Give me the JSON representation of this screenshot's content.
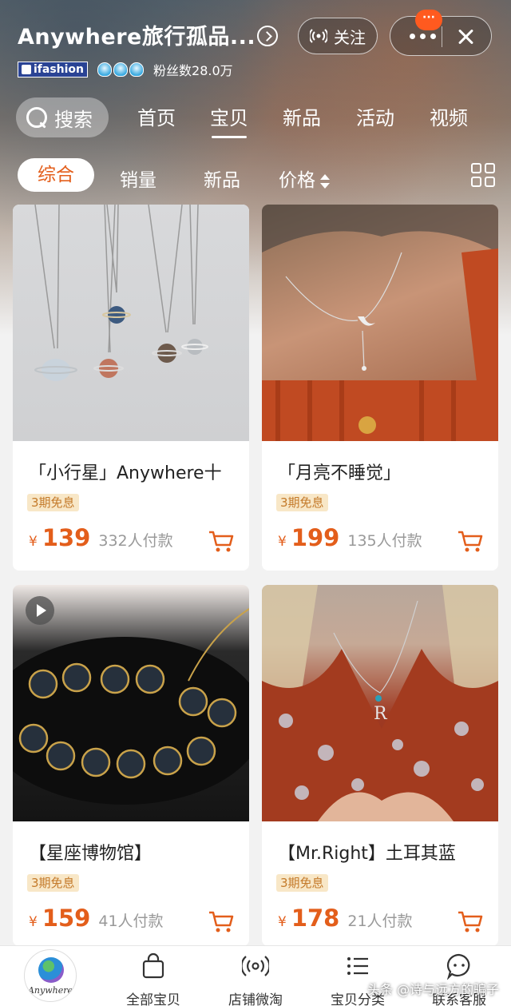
{
  "header": {
    "shop_name": "Anywhere旅行孤品...",
    "follow_label": "关注",
    "badge_dots": "···",
    "brand_badge": "ifashion",
    "fans_text": "粉丝数28.0万"
  },
  "nav": {
    "search_label": "搜索",
    "tabs": [
      {
        "label": "首页"
      },
      {
        "label": "宝贝"
      },
      {
        "label": "新品"
      },
      {
        "label": "活动"
      },
      {
        "label": "视频"
      }
    ]
  },
  "filters": {
    "items": [
      {
        "label": "综合"
      },
      {
        "label": "销量"
      },
      {
        "label": "新品"
      },
      {
        "label": "价格"
      }
    ]
  },
  "products": [
    {
      "name": "「小行星」Anywhere十",
      "badge": "3期免息",
      "currency": "¥",
      "price": "139",
      "sold": "332人付款"
    },
    {
      "name": "「月亮不睡觉」",
      "badge": "3期免息",
      "currency": "¥",
      "price": "199",
      "sold": "135人付款"
    },
    {
      "name": "【星座博物馆】",
      "badge": "3期免息",
      "currency": "¥",
      "price": "159",
      "sold": "41人付款"
    },
    {
      "name": "【Mr.Right】土耳其蓝",
      "badge": "3期免息",
      "currency": "¥",
      "price": "178",
      "sold": "21人付款"
    }
  ],
  "bottom_bar": {
    "avatar_text": "Anywhere",
    "items": [
      {
        "label": "全部宝贝",
        "icon": "shopping-bag-icon"
      },
      {
        "label": "店铺微淘",
        "icon": "broadcast-icon"
      },
      {
        "label": "宝贝分类",
        "icon": "list-icon"
      },
      {
        "label": "联系客服",
        "icon": "chat-bubble-icon"
      }
    ]
  },
  "watermark": "头条 @诗与远方的骗子",
  "colors": {
    "accent": "#e35e1b",
    "badge_bg": "#f8e7c7",
    "notification": "#ff5a1f"
  }
}
